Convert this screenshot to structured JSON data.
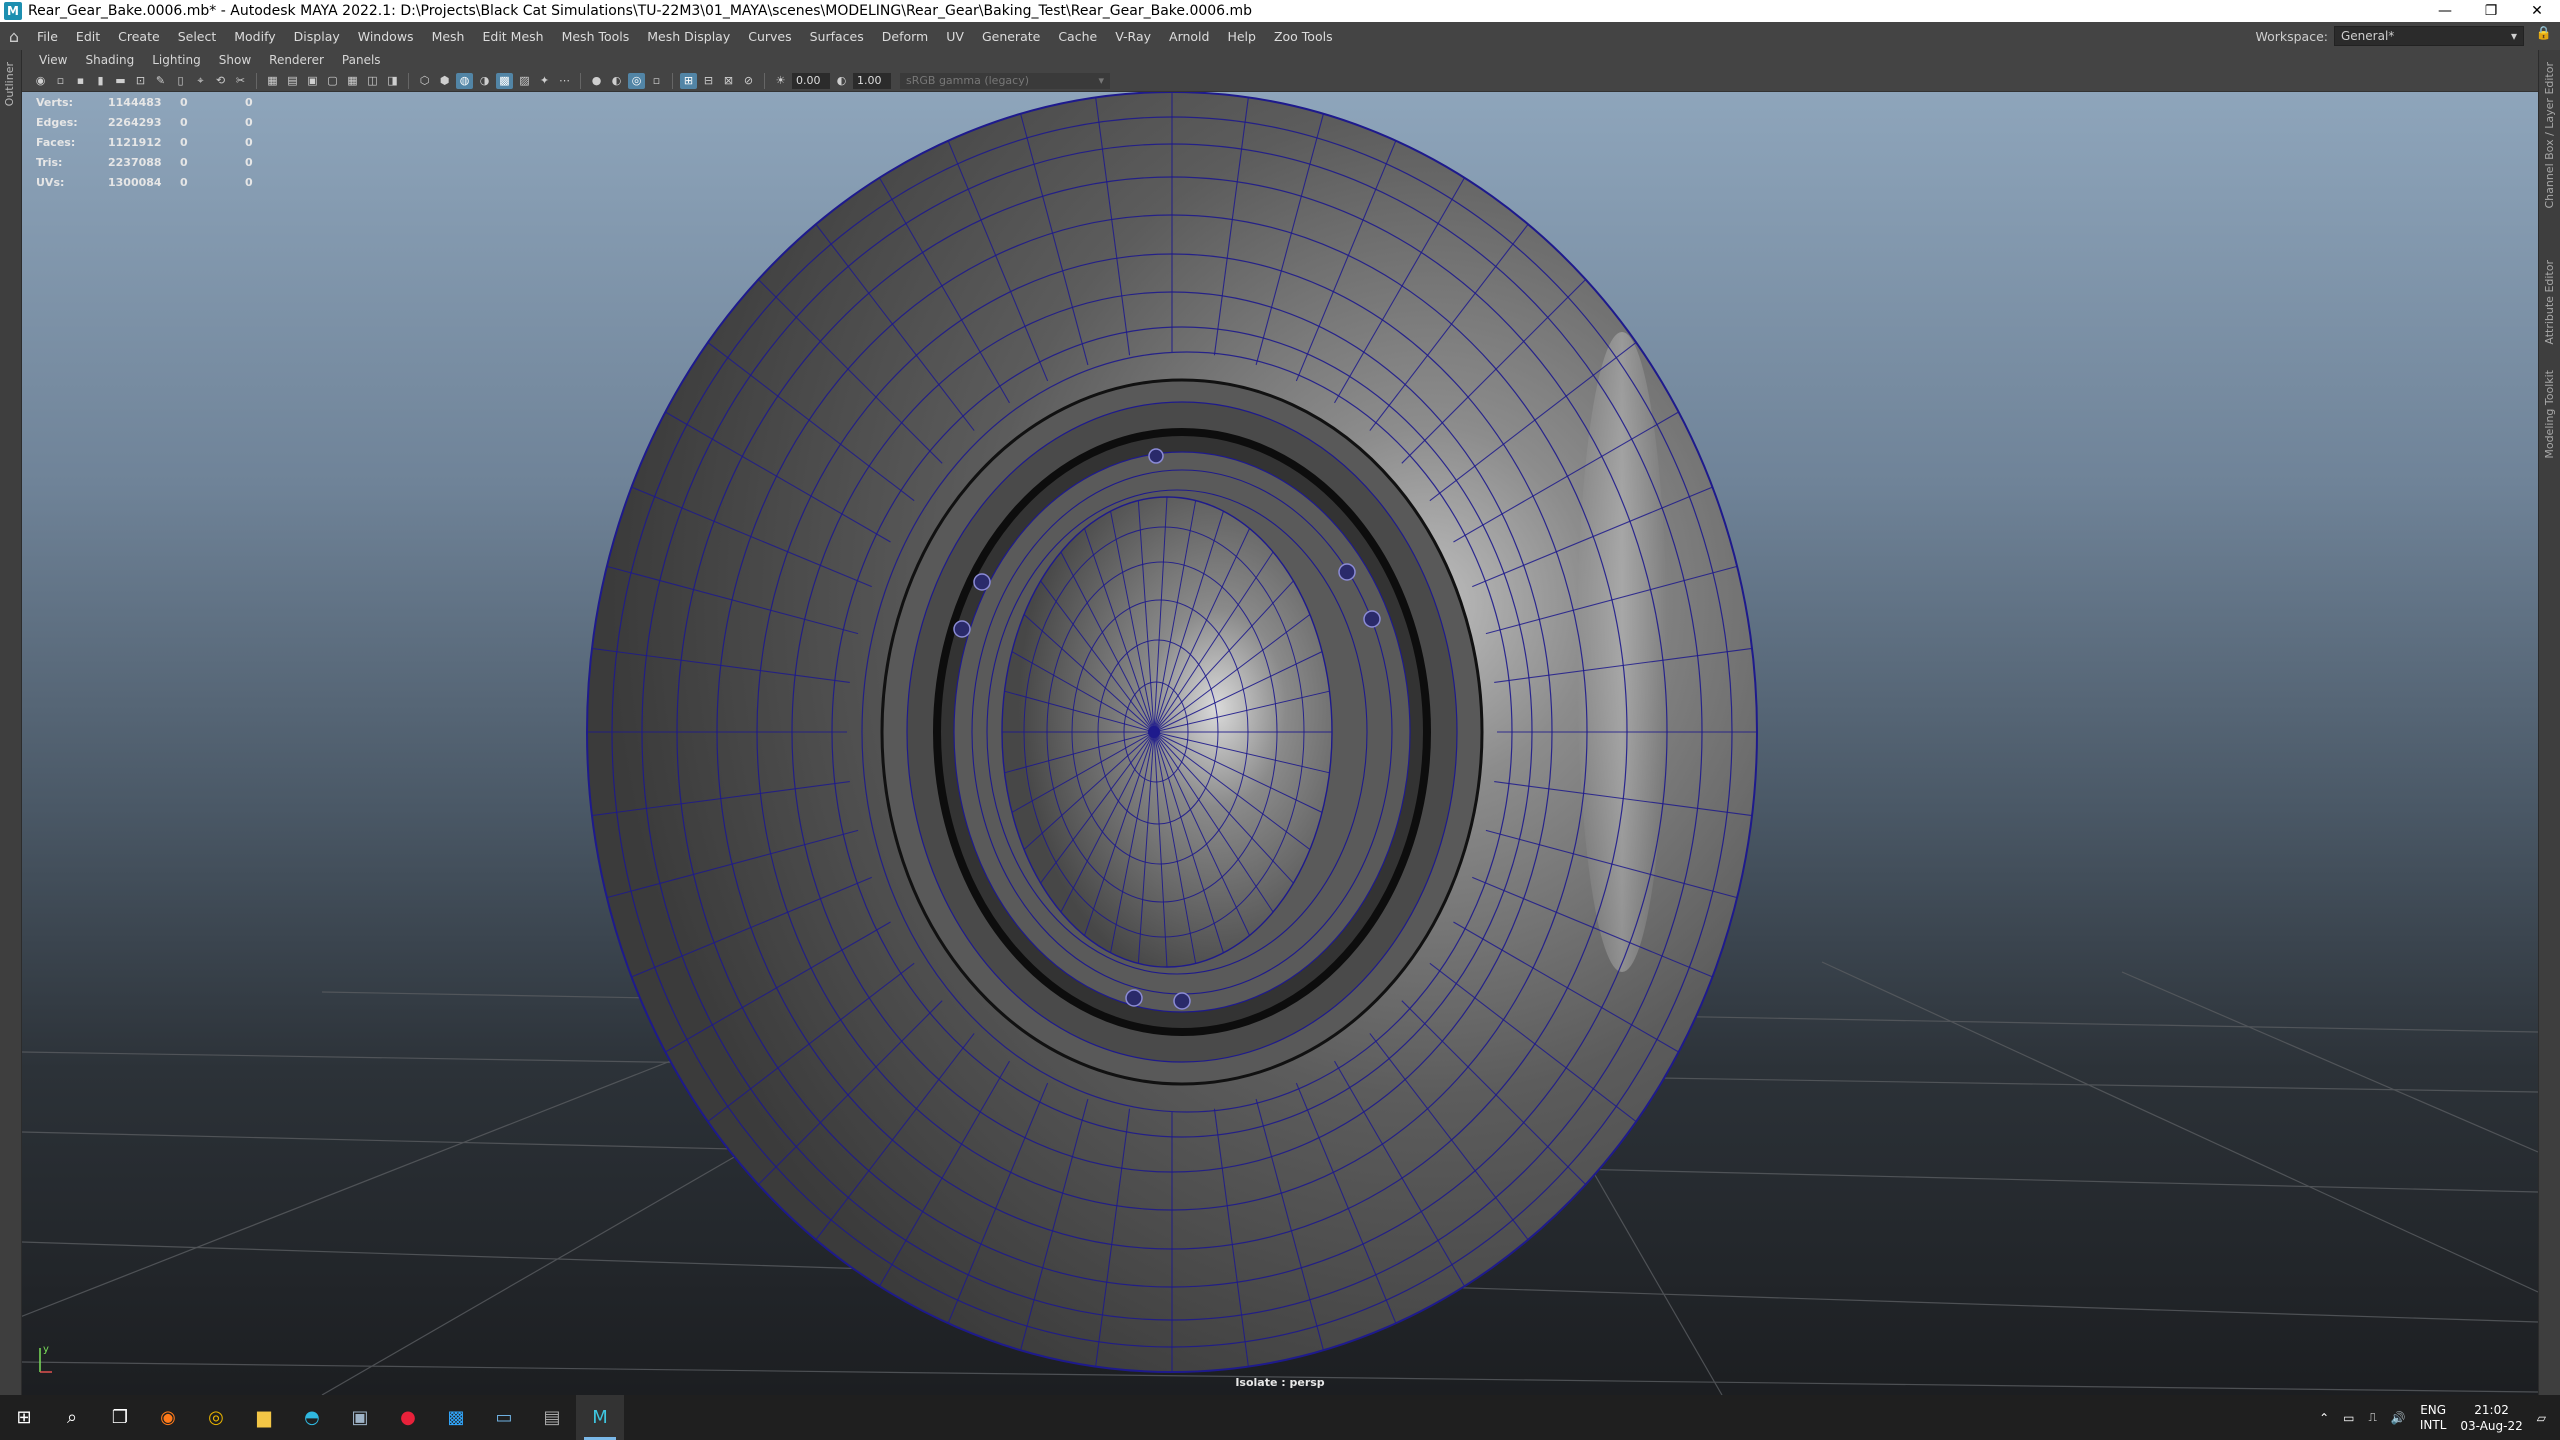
{
  "window": {
    "title": "Rear_Gear_Bake.0006.mb* - Autodesk MAYA 2022.1: D:\\Projects\\Black Cat Simulations\\TU-22M3\\01_MAYA\\scenes\\MODELING\\Rear_Gear\\Baking_Test\\Rear_Gear_Bake.0006.mb",
    "app_icon": "M",
    "controls": {
      "minimize": "—",
      "restore": "❐",
      "close": "✕"
    }
  },
  "menu": {
    "items": [
      "File",
      "Edit",
      "Create",
      "Select",
      "Modify",
      "Display",
      "Windows",
      "Mesh",
      "Edit Mesh",
      "Mesh Tools",
      "Mesh Display",
      "Curves",
      "Surfaces",
      "Deform",
      "UV",
      "Generate",
      "Cache",
      "V-Ray",
      "Arnold",
      "Help",
      "Zoo Tools"
    ],
    "workspace_label": "Workspace:",
    "workspace_value": "General*"
  },
  "side_tabs": {
    "left": "Outliner",
    "right": [
      "Channel Box / Layer Editor",
      "Attribute Editor",
      "Modeling Toolkit"
    ]
  },
  "panel_menu": [
    "View",
    "Shading",
    "Lighting",
    "Show",
    "Renderer",
    "Panels"
  ],
  "toolbar": {
    "exposure": "0.00",
    "gamma": "1.00",
    "color_space": "sRGB gamma (legacy)"
  },
  "hud": {
    "rows": [
      {
        "label": "Verts:",
        "v1": "1144483",
        "v2": "0",
        "v3": "0"
      },
      {
        "label": "Edges:",
        "v1": "2264293",
        "v2": "0",
        "v3": "0"
      },
      {
        "label": "Faces:",
        "v1": "1121912",
        "v2": "0",
        "v3": "0"
      },
      {
        "label": "Tris:",
        "v1": "2237088",
        "v2": "0",
        "v3": "0"
      },
      {
        "label": "UVs:",
        "v1": "1300084",
        "v2": "0",
        "v3": "0"
      }
    ]
  },
  "viewport": {
    "camera_label": "Isolate : persp",
    "wire_color": "#1e1a8c",
    "axis_y": "y"
  },
  "taskbar": {
    "icons": [
      "windows-start-icon",
      "search-icon",
      "task-view-icon",
      "firefox-icon",
      "chrome-icon",
      "file-explorer-icon",
      "edge-icon",
      "app-icon",
      "opera-icon",
      "photoshop-icon",
      "explorer-window-icon",
      "calculator-icon",
      "maya-icon"
    ],
    "lang_top": "ENG",
    "lang_bottom": "INTL",
    "time": "21:02",
    "date": "03-Aug-22"
  }
}
